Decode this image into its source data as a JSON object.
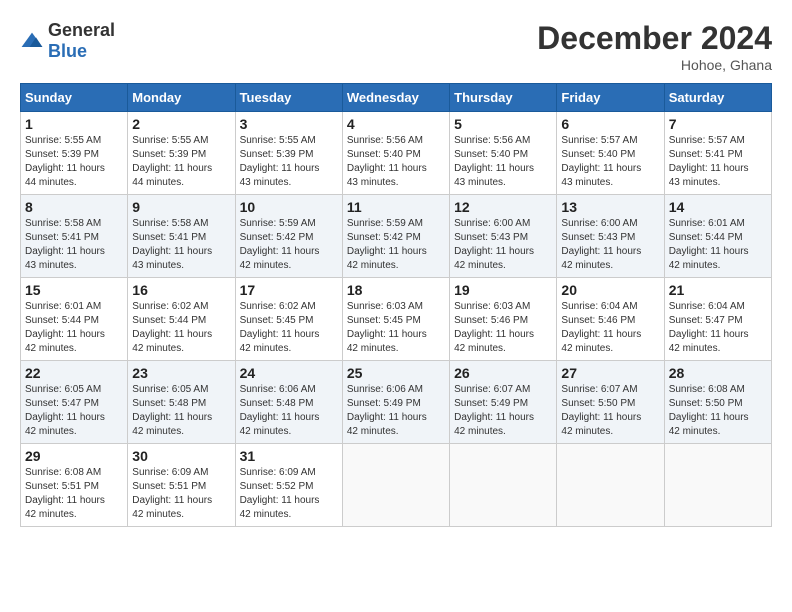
{
  "header": {
    "logo_general": "General",
    "logo_blue": "Blue",
    "month_title": "December 2024",
    "location": "Hohoe, Ghana"
  },
  "weekdays": [
    "Sunday",
    "Monday",
    "Tuesday",
    "Wednesday",
    "Thursday",
    "Friday",
    "Saturday"
  ],
  "weeks": [
    [
      {
        "day": "1",
        "sunrise": "5:55 AM",
        "sunset": "5:39 PM",
        "daylight": "11 hours and 44 minutes."
      },
      {
        "day": "2",
        "sunrise": "5:55 AM",
        "sunset": "5:39 PM",
        "daylight": "11 hours and 44 minutes."
      },
      {
        "day": "3",
        "sunrise": "5:55 AM",
        "sunset": "5:39 PM",
        "daylight": "11 hours and 43 minutes."
      },
      {
        "day": "4",
        "sunrise": "5:56 AM",
        "sunset": "5:40 PM",
        "daylight": "11 hours and 43 minutes."
      },
      {
        "day": "5",
        "sunrise": "5:56 AM",
        "sunset": "5:40 PM",
        "daylight": "11 hours and 43 minutes."
      },
      {
        "day": "6",
        "sunrise": "5:57 AM",
        "sunset": "5:40 PM",
        "daylight": "11 hours and 43 minutes."
      },
      {
        "day": "7",
        "sunrise": "5:57 AM",
        "sunset": "5:41 PM",
        "daylight": "11 hours and 43 minutes."
      }
    ],
    [
      {
        "day": "8",
        "sunrise": "5:58 AM",
        "sunset": "5:41 PM",
        "daylight": "11 hours and 43 minutes."
      },
      {
        "day": "9",
        "sunrise": "5:58 AM",
        "sunset": "5:41 PM",
        "daylight": "11 hours and 43 minutes."
      },
      {
        "day": "10",
        "sunrise": "5:59 AM",
        "sunset": "5:42 PM",
        "daylight": "11 hours and 42 minutes."
      },
      {
        "day": "11",
        "sunrise": "5:59 AM",
        "sunset": "5:42 PM",
        "daylight": "11 hours and 42 minutes."
      },
      {
        "day": "12",
        "sunrise": "6:00 AM",
        "sunset": "5:43 PM",
        "daylight": "11 hours and 42 minutes."
      },
      {
        "day": "13",
        "sunrise": "6:00 AM",
        "sunset": "5:43 PM",
        "daylight": "11 hours and 42 minutes."
      },
      {
        "day": "14",
        "sunrise": "6:01 AM",
        "sunset": "5:44 PM",
        "daylight": "11 hours and 42 minutes."
      }
    ],
    [
      {
        "day": "15",
        "sunrise": "6:01 AM",
        "sunset": "5:44 PM",
        "daylight": "11 hours and 42 minutes."
      },
      {
        "day": "16",
        "sunrise": "6:02 AM",
        "sunset": "5:44 PM",
        "daylight": "11 hours and 42 minutes."
      },
      {
        "day": "17",
        "sunrise": "6:02 AM",
        "sunset": "5:45 PM",
        "daylight": "11 hours and 42 minutes."
      },
      {
        "day": "18",
        "sunrise": "6:03 AM",
        "sunset": "5:45 PM",
        "daylight": "11 hours and 42 minutes."
      },
      {
        "day": "19",
        "sunrise": "6:03 AM",
        "sunset": "5:46 PM",
        "daylight": "11 hours and 42 minutes."
      },
      {
        "day": "20",
        "sunrise": "6:04 AM",
        "sunset": "5:46 PM",
        "daylight": "11 hours and 42 minutes."
      },
      {
        "day": "21",
        "sunrise": "6:04 AM",
        "sunset": "5:47 PM",
        "daylight": "11 hours and 42 minutes."
      }
    ],
    [
      {
        "day": "22",
        "sunrise": "6:05 AM",
        "sunset": "5:47 PM",
        "daylight": "11 hours and 42 minutes."
      },
      {
        "day": "23",
        "sunrise": "6:05 AM",
        "sunset": "5:48 PM",
        "daylight": "11 hours and 42 minutes."
      },
      {
        "day": "24",
        "sunrise": "6:06 AM",
        "sunset": "5:48 PM",
        "daylight": "11 hours and 42 minutes."
      },
      {
        "day": "25",
        "sunrise": "6:06 AM",
        "sunset": "5:49 PM",
        "daylight": "11 hours and 42 minutes."
      },
      {
        "day": "26",
        "sunrise": "6:07 AM",
        "sunset": "5:49 PM",
        "daylight": "11 hours and 42 minutes."
      },
      {
        "day": "27",
        "sunrise": "6:07 AM",
        "sunset": "5:50 PM",
        "daylight": "11 hours and 42 minutes."
      },
      {
        "day": "28",
        "sunrise": "6:08 AM",
        "sunset": "5:50 PM",
        "daylight": "11 hours and 42 minutes."
      }
    ],
    [
      {
        "day": "29",
        "sunrise": "6:08 AM",
        "sunset": "5:51 PM",
        "daylight": "11 hours and 42 minutes."
      },
      {
        "day": "30",
        "sunrise": "6:09 AM",
        "sunset": "5:51 PM",
        "daylight": "11 hours and 42 minutes."
      },
      {
        "day": "31",
        "sunrise": "6:09 AM",
        "sunset": "5:52 PM",
        "daylight": "11 hours and 42 minutes."
      },
      null,
      null,
      null,
      null
    ]
  ],
  "labels": {
    "sunrise": "Sunrise:",
    "sunset": "Sunset:",
    "daylight": "Daylight:"
  }
}
